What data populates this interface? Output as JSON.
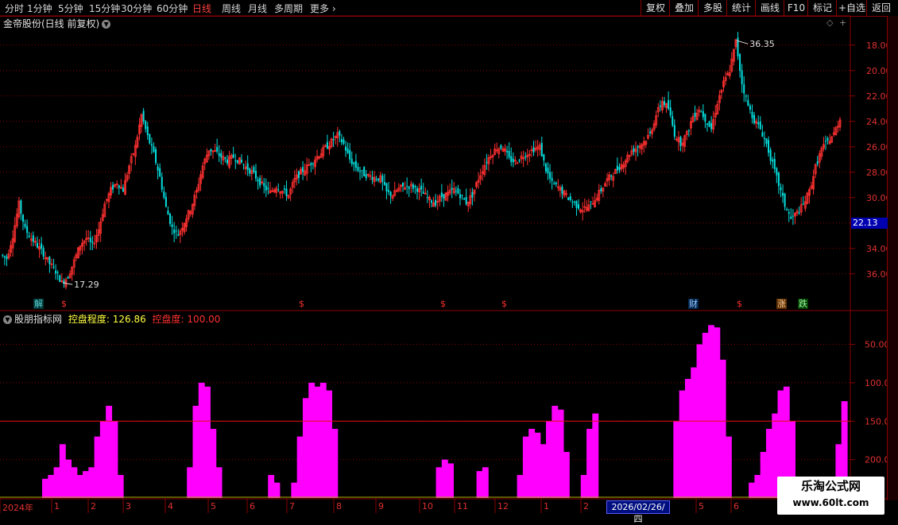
{
  "toolbar": {
    "periods": [
      "分时",
      "1分钟",
      "5分钟",
      "15分钟",
      "30分钟",
      "60分钟",
      "日线",
      "周线",
      "月线",
      "多周期",
      "更多"
    ],
    "active_period": "日线",
    "right_buttons": [
      "复权",
      "叠加",
      "多股",
      "统计",
      "画线",
      "F10",
      "标记",
      "+自选",
      "返回"
    ]
  },
  "stock": {
    "title": "金帝股份(日线 前复权)"
  },
  "price_panel": {
    "high_label": "36.35",
    "low_label": "17.29",
    "current_price": "22.13",
    "ticks": [
      "36.00",
      "34.00",
      "32.00",
      "30.00",
      "28.00",
      "26.00",
      "24.00",
      "22.00",
      "20.00",
      "18.00"
    ],
    "events": [
      {
        "text": "解",
        "color": "#5fd0d0",
        "bg": "#003838"
      },
      {
        "text": "$",
        "color": "#ff3030",
        "bg": ""
      },
      {
        "text": "$",
        "color": "#ff3030",
        "bg": ""
      },
      {
        "text": "$",
        "color": "#ff3030",
        "bg": ""
      },
      {
        "text": "$",
        "color": "#ff3030",
        "bg": ""
      },
      {
        "text": "财",
        "color": "#a0c8ff",
        "bg": "#002850"
      },
      {
        "text": "$",
        "color": "#ff3030",
        "bg": ""
      },
      {
        "text": "涨",
        "color": "#ffd0a0",
        "bg": "#603000"
      },
      {
        "text": "跌",
        "color": "#a0ffa0",
        "bg": "#004000"
      }
    ]
  },
  "indicator": {
    "name": "股朋指标网",
    "line1_label": "控盘程度:",
    "line1_value": "126.86",
    "line2_label": "控盘度:",
    "line2_value": "100.00",
    "ticks": [
      "200.0",
      "150.0",
      "100.0",
      "50.00"
    ]
  },
  "date_axis": {
    "labels": [
      "2024年",
      "1",
      "2",
      "3",
      "4",
      "5",
      "6",
      "7",
      "8",
      "9",
      "10",
      "11",
      "12",
      "1",
      "2",
      "5",
      "6"
    ],
    "cursor_date": "2026/02/26/四"
  },
  "colors": {
    "up": "#ff3030",
    "down": "#00e0e0",
    "histogram": "#ff00ff",
    "grid": "#8a0000",
    "axis_text": "#e03030"
  },
  "chart_data": [
    {
      "type": "candlestick",
      "title": "金帝股份(日线 前复权)",
      "ylim": [
        16.3,
        37.3
      ],
      "y_ticks": [
        18,
        20,
        22,
        24,
        26,
        28,
        30,
        32,
        34,
        36
      ],
      "max_value": 36.35,
      "min_value": 17.29,
      "last_value": 22.13,
      "close_path": [
        19.5,
        19.2,
        21.0,
        23.5,
        21.5,
        20.8,
        20.2,
        19.6,
        18.8,
        18.2,
        17.3,
        17.8,
        19.0,
        20.3,
        20.8,
        20.2,
        21.5,
        23.5,
        24.6,
        25.2,
        24.6,
        26.5,
        28.0,
        30.5,
        28.8,
        27.4,
        25.6,
        23.2,
        21.6,
        21.1,
        22.1,
        23.1,
        24.5,
        26.5,
        27.8,
        27.6,
        27.2,
        26.9,
        27.2,
        26.9,
        26.4,
        26.0,
        25.4,
        24.8,
        24.4,
        24.9,
        24.5,
        24.2,
        25.4,
        26.0,
        26.4,
        26.9,
        27.4,
        27.9,
        28.4,
        28.9,
        28.2,
        27.0,
        26.4,
        25.9,
        25.7,
        25.6,
        25.5,
        24.4,
        24.2,
        24.7,
        24.9,
        24.9,
        24.7,
        24.3,
        23.8,
        23.6,
        24.1,
        24.3,
        24.6,
        24.2,
        23.6,
        24.2,
        25.5,
        26.6,
        27.4,
        27.9,
        28.0,
        27.0,
        26.8,
        27.2,
        27.5,
        27.8,
        28.0,
        26.2,
        25.1,
        24.8,
        24.3,
        23.8,
        23.4,
        23.1,
        23.3,
        23.9,
        24.6,
        25.4,
        25.9,
        26.4,
        27.0,
        27.7,
        28.0,
        28.4,
        29.0,
        30.5,
        31.6,
        31.0,
        29.0,
        28.3,
        29.0,
        30.4,
        31.0,
        30.2,
        29.4,
        31.5,
        33.0,
        34.0,
        36.3,
        33.0,
        31.2,
        30.1,
        29.4,
        28.2,
        26.6,
        25.0,
        23.4,
        22.3,
        22.8,
        23.4,
        24.5,
        26.4,
        27.8,
        28.4,
        29.0,
        30.2
      ]
    },
    {
      "type": "area",
      "title": "股朋指标网",
      "ylim": [
        0,
        245
      ],
      "y_ticks": [
        50,
        100,
        150,
        200
      ],
      "reference_line": 100.0,
      "series": [
        {
          "name": "控盘程度",
          "last_value": 126.86,
          "values": [
            0,
            0,
            0,
            0,
            0,
            0,
            0,
            25,
            30,
            40,
            70,
            50,
            40,
            30,
            35,
            40,
            80,
            100,
            120,
            100,
            30,
            0,
            0,
            0,
            0,
            0,
            0,
            0,
            0,
            0,
            0,
            0,
            40,
            120,
            150,
            145,
            90,
            40,
            0,
            0,
            0,
            0,
            0,
            0,
            0,
            0,
            30,
            20,
            0,
            0,
            20,
            80,
            130,
            150,
            145,
            150,
            140,
            90,
            0,
            0,
            0,
            0,
            0,
            0,
            0,
            0,
            0,
            0,
            0,
            0,
            0,
            0,
            0,
            0,
            0,
            40,
            50,
            45,
            0,
            0,
            0,
            0,
            35,
            40,
            0,
            0,
            0,
            0,
            0,
            30,
            80,
            90,
            85,
            70,
            100,
            120,
            115,
            60,
            0,
            0,
            30,
            90,
            110,
            0,
            0,
            0,
            0,
            0,
            0,
            0,
            0,
            0,
            0,
            0,
            0,
            0,
            100,
            140,
            155,
            170,
            200,
            215,
            225,
            222,
            180,
            80,
            0,
            0,
            0,
            20,
            30,
            60,
            90,
            110,
            140,
            145,
            100,
            20,
            0,
            0,
            0,
            0,
            0,
            0,
            70,
            126
          ]
        }
      ]
    }
  ]
}
